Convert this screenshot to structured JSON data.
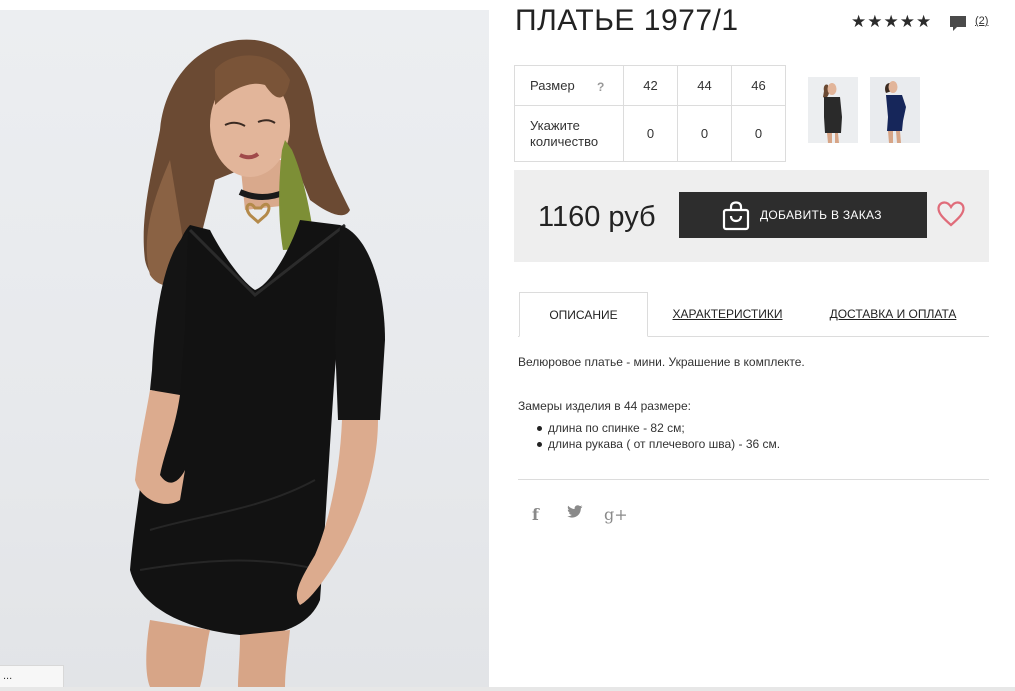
{
  "product": {
    "title": "ПЛАТЬЕ 1977/1",
    "rating_stars": "★★★★★",
    "reviews_count": "(2)",
    "price": "1160 руб"
  },
  "sizes": {
    "size_label": "Размер",
    "help_mark": "?",
    "values": [
      "42",
      "44",
      "46"
    ],
    "qty_label": "Укажите количество",
    "quantities": [
      "0",
      "0",
      "0"
    ]
  },
  "cart": {
    "add_label": "ДОБАВИТЬ В ЗАКАЗ"
  },
  "tabs": [
    {
      "label": "ОПИСАНИЕ",
      "active": true
    },
    {
      "label": "ХАРАКТЕРИСТИКИ",
      "active": false
    },
    {
      "label": "ДОСТАВКА И ОПЛАТА",
      "active": false
    }
  ],
  "description": {
    "text": "Велюровое платье - мини. Украшение в комплекте.",
    "measure_title": "Замеры изделия в 44 размере:",
    "measures": [
      "длина по спинке - 82 см;",
      "длина рукава ( от плечевого шва) - 36 см."
    ]
  },
  "social": {
    "facebook": "f",
    "twitter": "twitter-icon",
    "googleplus": "g+"
  },
  "status_bar": {
    "text": "..."
  },
  "colors": {
    "button": "#2d2d2d",
    "price_bg": "#eeeeee",
    "heart": "#e06c7a",
    "accent_earring": "#8a9a3a"
  }
}
